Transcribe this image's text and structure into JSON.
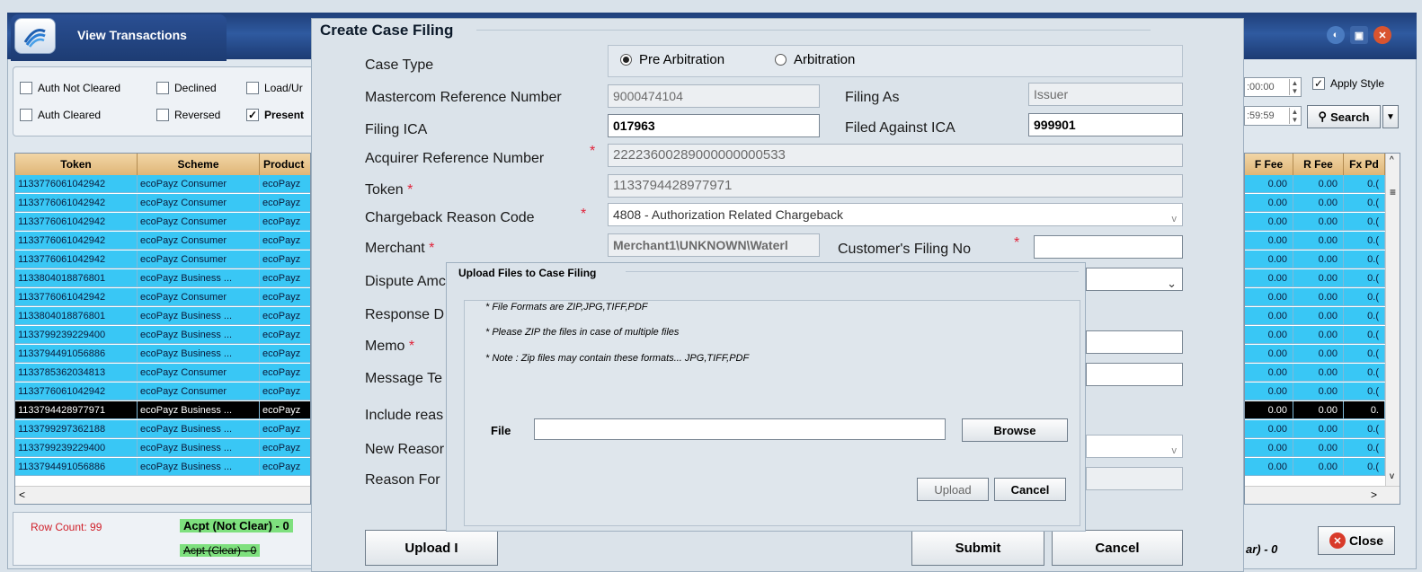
{
  "app": {
    "title": "View Transactions",
    "window_buttons": [
      "minimize-icon",
      "restore-icon",
      "close-icon"
    ]
  },
  "filters": {
    "checkboxes": [
      {
        "label": "Auth Not Cleared",
        "checked": false
      },
      {
        "label": "Declined",
        "checked": false
      },
      {
        "label": "Load/Ur",
        "checked": false
      },
      {
        "label": "Auth Cleared",
        "checked": false
      },
      {
        "label": "Reversed",
        "checked": false
      },
      {
        "label": "Present",
        "checked": true
      }
    ],
    "time_from": ":00:00",
    "time_to": ":59:59",
    "apply_style_label": "Apply Style",
    "apply_style_checked": true,
    "search_label": "Search"
  },
  "grid": {
    "columns": [
      "Token",
      "Scheme",
      "Product"
    ],
    "rows": [
      [
        "1133776061042942",
        "ecoPayz Consumer",
        "ecoPayz"
      ],
      [
        "1133776061042942",
        "ecoPayz Consumer",
        "ecoPayz"
      ],
      [
        "1133776061042942",
        "ecoPayz Consumer",
        "ecoPayz"
      ],
      [
        "1133776061042942",
        "ecoPayz Consumer",
        "ecoPayz"
      ],
      [
        "1133776061042942",
        "ecoPayz Consumer",
        "ecoPayz"
      ],
      [
        "1133804018876801",
        "ecoPayz Business ...",
        "ecoPayz"
      ],
      [
        "1133776061042942",
        "ecoPayz Consumer",
        "ecoPayz"
      ],
      [
        "1133804018876801",
        "ecoPayz Business ...",
        "ecoPayz"
      ],
      [
        "1133799239229400",
        "ecoPayz Business ...",
        "ecoPayz"
      ],
      [
        "1133794491056886",
        "ecoPayz Business ...",
        "ecoPayz"
      ],
      [
        "1133785362034813",
        "ecoPayz Consumer",
        "ecoPayz"
      ],
      [
        "1133776061042942",
        "ecoPayz Consumer",
        "ecoPayz"
      ],
      [
        "1133794428977971",
        "ecoPayz Business ...",
        "ecoPayz"
      ],
      [
        "1133799297362188",
        "ecoPayz Business ...",
        "ecoPayz"
      ],
      [
        "1133799239229400",
        "ecoPayz Business ...",
        "ecoPayz"
      ],
      [
        "1133794491056886",
        "ecoPayz Business ...",
        "ecoPayz"
      ]
    ],
    "selected_row": 12,
    "right_columns": [
      "F Fee",
      "R Fee",
      "Fx Pd"
    ],
    "right_value": "0.00",
    "right_trunc": "0.(",
    "right_trunc_selected": "0."
  },
  "status": {
    "row_count": "Row Count: 99",
    "acpt_not_clear": "Acpt (Not Clear) - 0",
    "acpt_clear": "Acpt (Clear) - 0",
    "right_status": "ar) - 0",
    "close_label": "Close"
  },
  "case_filing": {
    "title": "Create Case Filing",
    "case_type_label": "Case Type",
    "radio_pre": "Pre Arbitration",
    "radio_arb": "Arbitration",
    "mastercom_label": "Mastercom Reference Number",
    "mastercom_value": "9000474104",
    "filing_as_label": "Filing As",
    "filing_as_value": "Issuer",
    "filing_ica_label": "Filing ICA",
    "filing_ica_value": "017963",
    "filed_against_label": "Filed Against ICA",
    "filed_against_value": "999901",
    "arn_label": "Acquirer Reference Number",
    "arn_value": "22223600289000000000533",
    "token_label": "Token",
    "token_value": "1133794428977971",
    "cb_reason_label": "Chargeback Reason Code",
    "cb_reason_value": "4808 - Authorization Related Chargeback",
    "merchant_label": "Merchant",
    "merchant_value": "Merchant1\\UNKNOWN\\Waterl",
    "customer_filing_label": "Customer's Filing No",
    "dispute_label": "Dispute Amc",
    "response_label": "Response D",
    "memo_label": "Memo",
    "message_label": "Message Te",
    "include_label": "Include reas",
    "new_reason_label": "New Reasor",
    "reason_for_label": "Reason For",
    "upload_file_btn": "Upload I",
    "submit_btn": "Submit",
    "cancel_btn": "Cancel"
  },
  "upload_dialog": {
    "title": "Upload Files to Case Filing",
    "note1": "* File Formats are ZIP,JPG,TIFF,PDF",
    "note2": "* Please ZIP the files in case of multiple files",
    "note3": "* Note : Zip files may contain these formats... JPG,TIFF,PDF",
    "file_label": "File",
    "file_value": "",
    "browse_label": "Browse",
    "upload_label": "Upload",
    "cancel_label": "Cancel"
  }
}
